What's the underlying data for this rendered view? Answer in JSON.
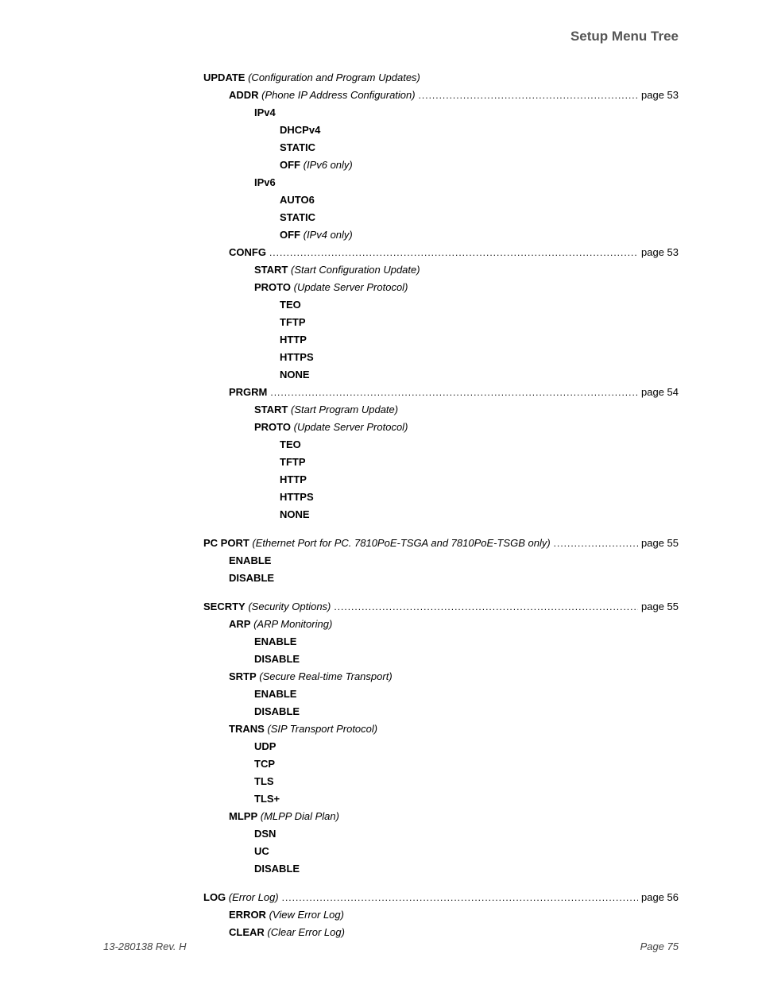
{
  "header": {
    "title": "Setup Menu Tree"
  },
  "footer": {
    "left": "13-280138  Rev. H",
    "right": "Page 75"
  },
  "lines": [
    {
      "level": 0,
      "bold": "UPDATE",
      "italic": "  (Configuration and Program Updates)"
    },
    {
      "level": 1,
      "bold": "ADDR",
      "italic": "  (Phone IP Address Configuration) ",
      "leader": true,
      "page": "page 53"
    },
    {
      "level": 2,
      "bold": "IPv4"
    },
    {
      "level": 3,
      "bold": "DHCPv4"
    },
    {
      "level": 3,
      "bold": "STATIC"
    },
    {
      "level": 3,
      "bold": "OFF",
      "italic": " (IPv6 only)"
    },
    {
      "level": 2,
      "bold": "IPv6"
    },
    {
      "level": 3,
      "bold": "AUTO6"
    },
    {
      "level": 3,
      "bold": "STATIC"
    },
    {
      "level": 3,
      "bold": "OFF",
      "italic": "  (IPv4 only)"
    },
    {
      "level": 1,
      "bold": "CONFG",
      "leader": true,
      "page": "page 53"
    },
    {
      "level": 2,
      "bold": "START",
      "italic": "  (Start Configuration Update)"
    },
    {
      "level": 2,
      "bold": "PROTO",
      "italic": "  (Update Server Protocol)"
    },
    {
      "level": 3,
      "bold": "TEO"
    },
    {
      "level": 3,
      "bold": "TFTP"
    },
    {
      "level": 3,
      "bold": "HTTP"
    },
    {
      "level": 3,
      "bold": "HTTPS"
    },
    {
      "level": 3,
      "bold": "NONE"
    },
    {
      "level": 1,
      "bold": "PRGRM ",
      "leader": true,
      "page": "page 54"
    },
    {
      "level": 2,
      "bold": "START",
      "italic": "  (Start Program Update)"
    },
    {
      "level": 2,
      "bold": "PROTO",
      "italic": "  (Update Server Protocol)"
    },
    {
      "level": 3,
      "bold": "TEO"
    },
    {
      "level": 3,
      "bold": "TFTP"
    },
    {
      "level": 3,
      "bold": "HTTP"
    },
    {
      "level": 3,
      "bold": "HTTPS"
    },
    {
      "level": 3,
      "bold": "NONE"
    },
    {
      "gap": true
    },
    {
      "level": 0,
      "bold": "PC PORT",
      "italic": "  (Ethernet Port for PC. 7810PoE-TSGA and 7810PoE-TSGB only) ",
      "leader": true,
      "page": "page 55"
    },
    {
      "level": 1,
      "bold": "ENABLE"
    },
    {
      "level": 1,
      "bold": "DISABLE"
    },
    {
      "gap": true
    },
    {
      "level": 0,
      "bold": "SECRTY",
      "italic": "  (Security Options) ",
      "leader": true,
      "page": " page 55"
    },
    {
      "level": 1,
      "bold": "ARP",
      "italic": "  (ARP Monitoring)"
    },
    {
      "level": 2,
      "bold": "ENABLE"
    },
    {
      "level": 2,
      "bold": "DISABLE"
    },
    {
      "level": 1,
      "bold": "SRTP",
      "italic": "  (Secure Real-time Transport)"
    },
    {
      "level": 2,
      "bold": "ENABLE"
    },
    {
      "level": 2,
      "bold": "DISABLE"
    },
    {
      "level": 1,
      "bold": "TRANS",
      "italic": "  (SIP Transport Protocol)"
    },
    {
      "level": 2,
      "bold": "UDP"
    },
    {
      "level": 2,
      "bold": "TCP"
    },
    {
      "level": 2,
      "bold": "TLS"
    },
    {
      "level": 2,
      "bold": "TLS+"
    },
    {
      "level": 1,
      "bold": "MLPP",
      "italic": "  (MLPP Dial Plan)"
    },
    {
      "level": 2,
      "bold": "DSN"
    },
    {
      "level": 2,
      "bold": "UC"
    },
    {
      "level": 2,
      "bold": "DISABLE"
    },
    {
      "gap": true
    },
    {
      "level": 0,
      "bold": "LOG",
      "italic": "  (Error Log) ",
      "leader": true,
      "page": "page 56"
    },
    {
      "level": 1,
      "bold": "ERROR",
      "italic": "  (View Error Log)"
    },
    {
      "level": 1,
      "bold": "CLEAR",
      "italic": "  (Clear Error Log)"
    }
  ]
}
